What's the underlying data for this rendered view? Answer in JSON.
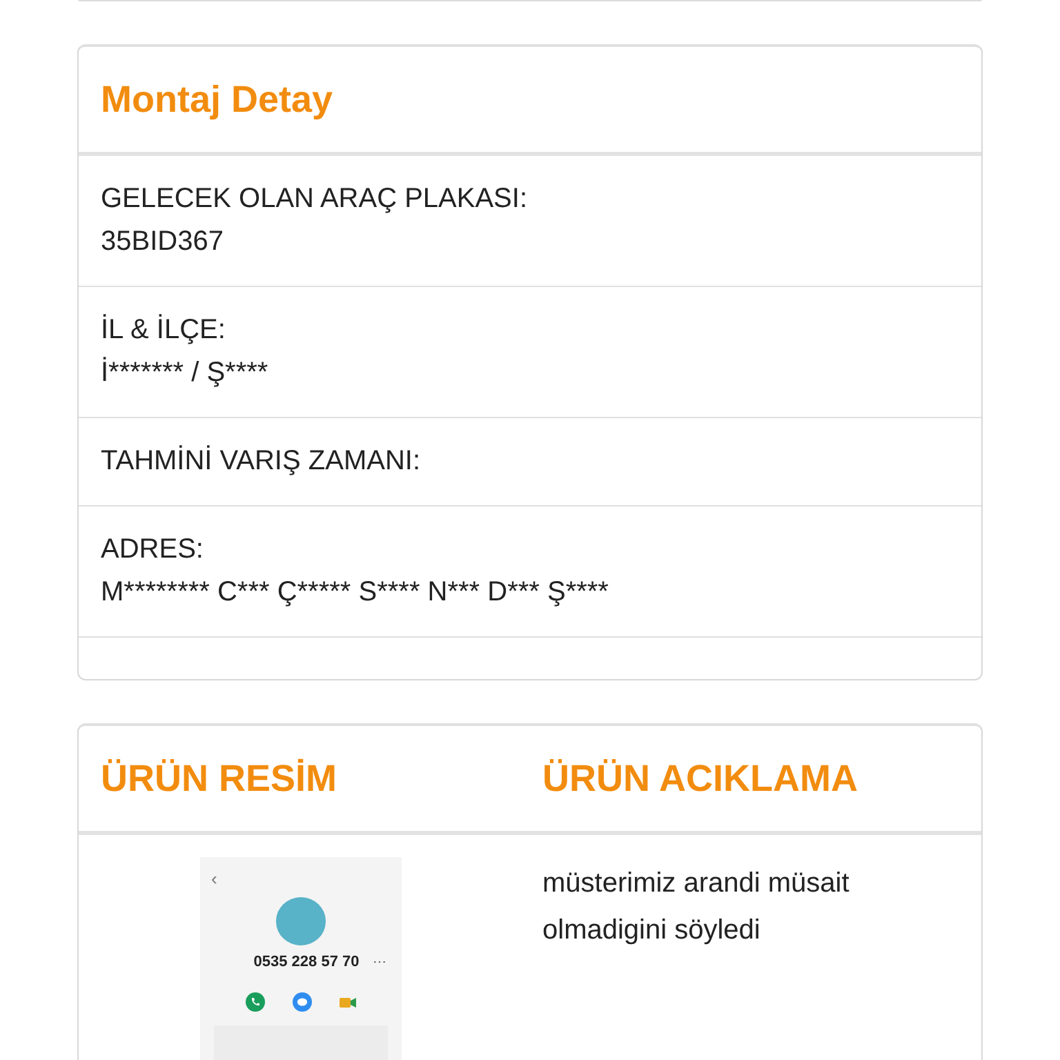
{
  "montaj_detay": {
    "title": "Montaj Detay",
    "fields": [
      {
        "label": "GELECEK OLAN ARAÇ PLAKASI:",
        "value": "35BID367"
      },
      {
        "label": "İL & İLÇE:",
        "value": "İ******* / Ş****"
      },
      {
        "label": "TAHMİNİ VARIŞ ZAMANI:"
      },
      {
        "label": "ADRES:",
        "value": "M******** C*** Ç***** S**** N*** D*** Ş****"
      }
    ]
  },
  "urun": {
    "columns": [
      "ÜRÜN RESİM",
      "ÜRÜN ACIKLAMA"
    ],
    "screenshot": {
      "back": "‹",
      "phone": "0535 228 57 70",
      "more": "⋯"
    },
    "description": "müsterimiz arandi müsait olmadigini söyledi"
  }
}
